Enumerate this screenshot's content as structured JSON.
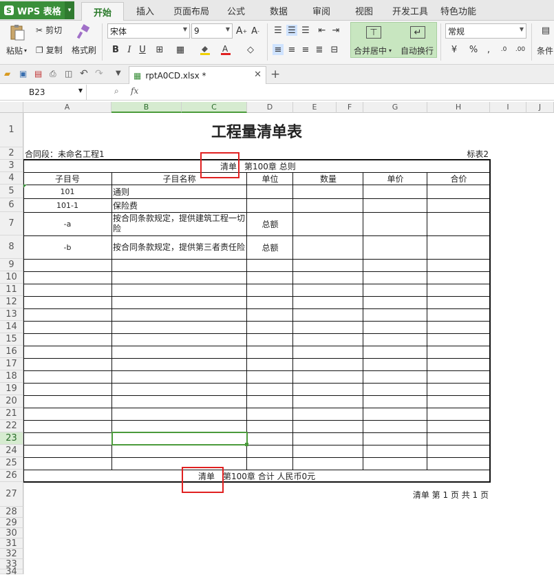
{
  "app": {
    "name": "WPS 表格",
    "logo": "S"
  },
  "menu_tabs": [
    "开始",
    "插入",
    "页面布局",
    "公式",
    "数据",
    "审阅",
    "视图",
    "开发工具",
    "特色功能"
  ],
  "ribbon": {
    "paste": "粘贴",
    "cut": "剪切",
    "copy": "复制",
    "format_painter": "格式刷",
    "font_name": "宋体",
    "font_size": "9",
    "merge_center": "合并居中",
    "wrap_text": "自动换行",
    "number_format": "常规",
    "conditional": "条件"
  },
  "file_tab": {
    "name": "rptA0CD.xlsx *"
  },
  "formula_bar": {
    "name_box": "B23",
    "fx": "fx",
    "value": ""
  },
  "columns": [
    "A",
    "B",
    "C",
    "D",
    "E",
    "F",
    "G",
    "H",
    "I",
    "J"
  ],
  "rows": [
    "1",
    "2",
    "3",
    "4",
    "5",
    "6",
    "7",
    "8",
    "9",
    "10",
    "11",
    "12",
    "13",
    "14",
    "15",
    "16",
    "17",
    "18",
    "19",
    "20",
    "21",
    "22",
    "23",
    "24",
    "25",
    "26",
    "27",
    "28",
    "29",
    "30",
    "31",
    "32",
    "33",
    "34"
  ],
  "sheet": {
    "title": "工程量清单表",
    "contract_label": "合同段：未命名工程1",
    "table_no": "标表2",
    "list_label": "清单",
    "chapter": "第100章  总则",
    "headers": [
      "子目号",
      "子目名称",
      "单位",
      "数量",
      "单价",
      "合价"
    ],
    "items": [
      {
        "code": "101",
        "name": "通则",
        "unit": ""
      },
      {
        "code": "101-1",
        "name": "保险费",
        "unit": ""
      },
      {
        "code": "-a",
        "name": "按合同条款规定，提供建筑工程一切险",
        "unit": "总额"
      },
      {
        "code": "-b",
        "name": "按合同条款规定，提供第三者责任险",
        "unit": "总额"
      }
    ],
    "footer_list_label": "清单",
    "footer_total": "第100章  合计  人民币0元",
    "page_info": "清单  第   1   页   共   1   页"
  },
  "colors": {
    "accent": "#3a8f3a",
    "selection": "#4a9a3a",
    "highlight_box": "#e02020"
  }
}
